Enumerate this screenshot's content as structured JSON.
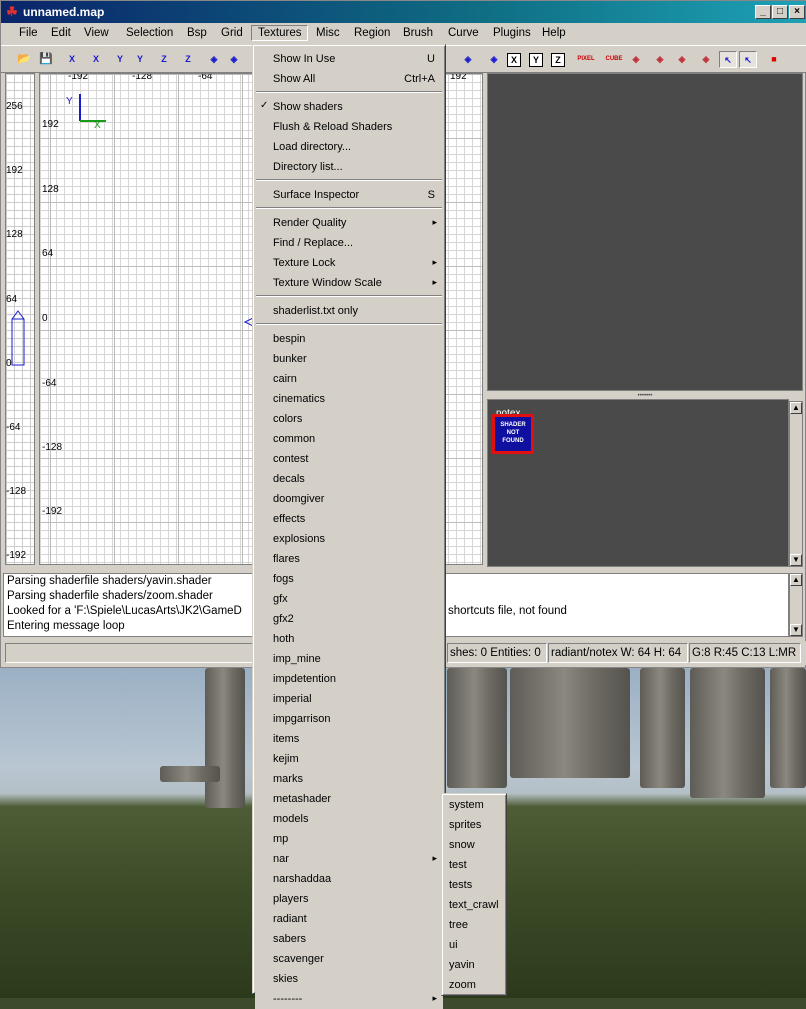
{
  "window": {
    "title": "unnamed.map"
  },
  "menubar": [
    "File",
    "Edit",
    "View",
    "Selection",
    "Bsp",
    "Grid",
    "Textures",
    "Misc",
    "Region",
    "Brush",
    "Curve",
    "Plugins",
    "Help"
  ],
  "toolbar": {
    "buttons": [
      "open-icon",
      "save-icon",
      "x-axis-icon",
      "x-axis-icon",
      "y-axis-icon",
      "y-axis-icon",
      "z-axis-icon",
      "z-axis-icon",
      "brush-icon",
      "brush-icon",
      "rotate-icon",
      "select-icon",
      "x-icon",
      "y-icon",
      "z-icon",
      "pixel-icon",
      "cube-icon",
      "clip-icon",
      "patch-icon",
      "camera-icon",
      "light-icon",
      "select-icon",
      "drag-icon",
      "red-cube-icon"
    ],
    "labels": {
      "x": "X",
      "y": "Y",
      "z": "Z",
      "pixel": "PIXEL",
      "cube": "CUBE"
    }
  },
  "grid": {
    "top_labels": [
      "-192",
      "-128",
      "-64",
      "192"
    ],
    "left_labels": [
      "192",
      "128",
      "64",
      "0",
      "-64",
      "-128",
      "-192"
    ],
    "side_labels": [
      "256",
      "192",
      "128",
      "64",
      "0",
      "-64",
      "-128",
      "-192"
    ],
    "axis": {
      "x": "X",
      "y": "Y"
    }
  },
  "texwin": {
    "label": "notex",
    "thumb_text": [
      "SHADER",
      "NOT",
      "FOUND"
    ]
  },
  "console": [
    "Parsing shaderfile shaders/yavin.shader",
    "Parsing shaderfile shaders/zoom.shader",
    "Looked for a 'F:\\Spiele\\LucasArts\\JK2\\GameD",
    "Entering message loop"
  ],
  "console_tail": "shortcuts file, not found",
  "status": {
    "brushes": "shes: 0 Entities: 0",
    "texture": "radiant/notex W: 64 H: 64",
    "grid": "G:8 R:45 C:13 L:MR"
  },
  "menu": {
    "items": [
      {
        "label": "Show In Use",
        "accel": "U"
      },
      {
        "label": "Show All",
        "accel": "Ctrl+A"
      },
      {
        "sep": true
      },
      {
        "label": "Show shaders",
        "check": "✓"
      },
      {
        "label": "Flush & Reload Shaders"
      },
      {
        "label": "Load directory..."
      },
      {
        "label": "Directory list..."
      },
      {
        "sep": true
      },
      {
        "label": "Surface Inspector",
        "accel": "S"
      },
      {
        "sep": true
      },
      {
        "label": "Render Quality",
        "sub": true
      },
      {
        "label": "Find / Replace..."
      },
      {
        "label": "Texture Lock",
        "sub": true
      },
      {
        "label": "Texture Window Scale",
        "sub": true
      },
      {
        "sep": true
      },
      {
        "label": "shaderlist.txt only"
      },
      {
        "sep": true
      },
      {
        "label": "bespin"
      },
      {
        "label": "bunker"
      },
      {
        "label": "cairn"
      },
      {
        "label": "cinematics"
      },
      {
        "label": "colors"
      },
      {
        "label": "common"
      },
      {
        "label": "contest"
      },
      {
        "label": "decals"
      },
      {
        "label": "doomgiver"
      },
      {
        "label": "effects"
      },
      {
        "label": "explosions"
      },
      {
        "label": "flares"
      },
      {
        "label": "fogs"
      },
      {
        "label": "gfx"
      },
      {
        "label": "gfx2"
      },
      {
        "label": "hoth"
      },
      {
        "label": "imp_mine"
      },
      {
        "label": "impdetention"
      },
      {
        "label": "imperial"
      },
      {
        "label": "impgarrison"
      },
      {
        "label": "items"
      },
      {
        "label": "kejim"
      },
      {
        "label": "marks"
      },
      {
        "label": "metashader"
      },
      {
        "label": "models"
      },
      {
        "label": "mp"
      },
      {
        "label": "nar",
        "sub": true
      },
      {
        "label": "narshaddaa"
      },
      {
        "label": "players"
      },
      {
        "label": "radiant"
      },
      {
        "label": "sabers"
      },
      {
        "label": "scavenger"
      },
      {
        "label": "skies"
      },
      {
        "label": "--------",
        "sub": true,
        "highlight": true
      }
    ]
  },
  "submenu": [
    "system",
    "sprites",
    "snow",
    "test",
    "tests",
    "text_crawl",
    "tree",
    "ui",
    "yavin",
    "zoom"
  ]
}
